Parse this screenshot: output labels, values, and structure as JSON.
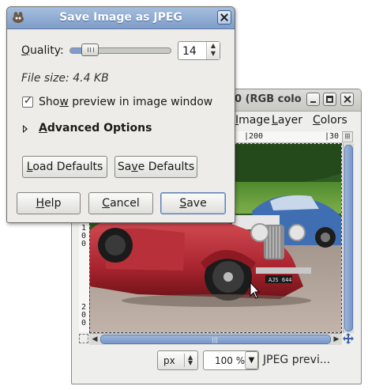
{
  "dialog": {
    "title": "Save Image as JPEG",
    "quality_label_pre": "",
    "quality_label_u": "Q",
    "quality_label_post": "uality:",
    "quality_value": "14",
    "quality_fraction": 0.14,
    "file_size": "File size: 4.4 KB",
    "preview_pre": "Sho",
    "preview_u": "w",
    "preview_post": " preview in image window",
    "preview_checked": true,
    "advanced_u": "A",
    "advanced_post": "dvanced Options",
    "load_defaults_u": "L",
    "load_defaults_post": "oad Defaults",
    "save_defaults_pre": "Sa",
    "save_defaults_u": "v",
    "save_defaults_post": "e Defaults",
    "help_u": "H",
    "help_post": "elp",
    "cancel_u": "C",
    "cancel_post": "ancel",
    "save_u": "S",
    "save_post": "ave"
  },
  "image_window": {
    "title_fragment": "0 (RGB colo",
    "menu": [
      {
        "pre": "",
        "u": "I",
        "post": "mage"
      },
      {
        "pre": "",
        "u": "L",
        "post": "ayer"
      },
      {
        "pre": "",
        "u": "C",
        "post": "olors"
      }
    ],
    "ruler_h": [
      "|200",
      "|30"
    ],
    "ruler_v_top": [
      "1",
      "0",
      "0"
    ],
    "ruler_v_bottom": [
      "2",
      "0",
      "0"
    ],
    "unit": "px",
    "zoom": "100 %",
    "status": "JPEG previ..."
  },
  "colors": {
    "titlebar_active": "#8aa7d0",
    "scroll_thumb": "#7796c9"
  }
}
